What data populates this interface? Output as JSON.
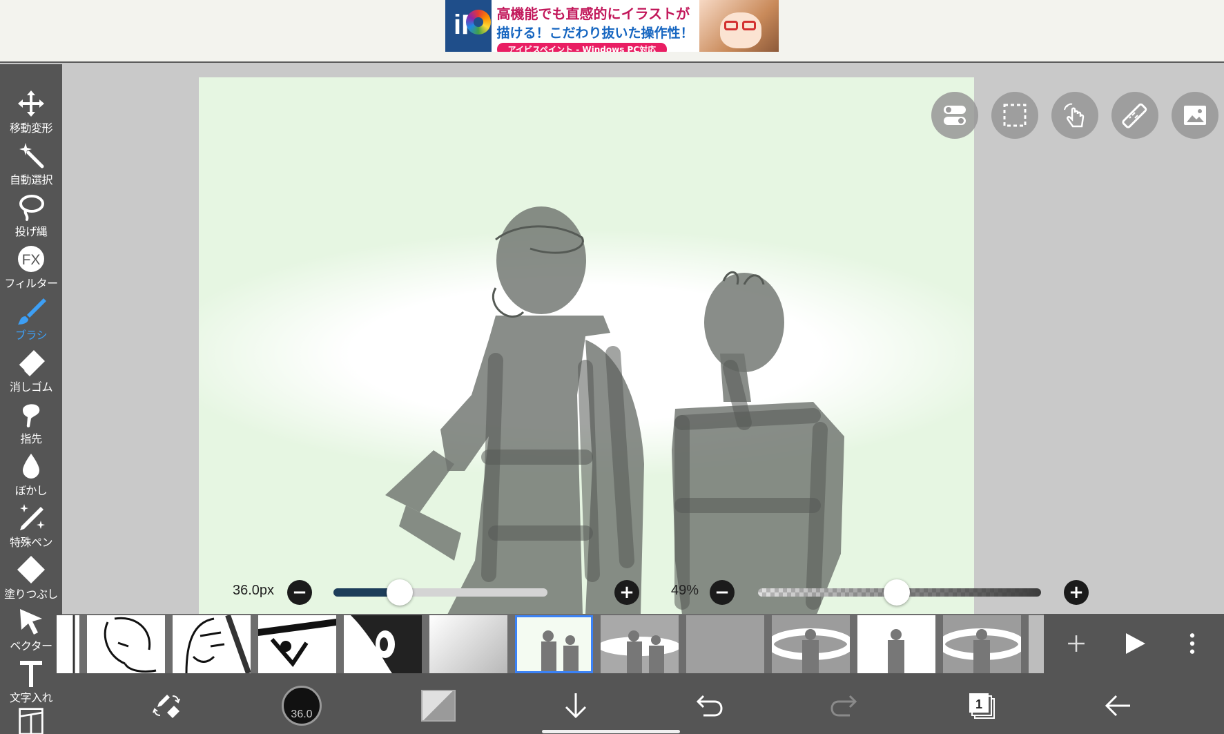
{
  "ad": {
    "logo": "iP",
    "line1": "高機能でも直感的にイラストが",
    "line2": "描ける！こだわり抜いた操作性！",
    "tagline": "アイビスペイント - Windows PC対応"
  },
  "tools": [
    {
      "id": "move",
      "label": "移動変形",
      "icon": "move-icon"
    },
    {
      "id": "magic",
      "label": "自動選択",
      "icon": "magic-wand-icon"
    },
    {
      "id": "lasso",
      "label": "投げ縄",
      "icon": "lasso-icon"
    },
    {
      "id": "filter",
      "label": "フィルター",
      "icon": "fx-icon"
    },
    {
      "id": "brush",
      "label": "ブラシ",
      "icon": "brush-icon",
      "active": true
    },
    {
      "id": "eraser",
      "label": "消しゴム",
      "icon": "eraser-icon"
    },
    {
      "id": "smudge",
      "label": "指先",
      "icon": "finger-icon"
    },
    {
      "id": "blur",
      "label": "ぼかし",
      "icon": "drop-icon"
    },
    {
      "id": "special",
      "label": "特殊ペン",
      "icon": "sparkle-pen-icon"
    },
    {
      "id": "fill",
      "label": "塗りつぶし",
      "icon": "bucket-icon"
    },
    {
      "id": "vector",
      "label": "ベクター",
      "icon": "cursor-icon"
    },
    {
      "id": "text",
      "label": "文字入れ",
      "icon": "text-icon"
    }
  ],
  "floating_buttons": [
    "toggle-icon",
    "selection-icon",
    "hand-icon",
    "ruler-icon",
    "image-icon"
  ],
  "brush_size": {
    "label": "36.0px",
    "fraction": 0.31
  },
  "opacity": {
    "label": "49%",
    "fraction": 0.49
  },
  "brush_size_badge": "36.0",
  "layers": {
    "count_badge": "1",
    "selected_index": 5
  },
  "colors": {
    "accent": "#3d9ff5",
    "toolbar_bg": "#555555",
    "canvas_bg": "#e6f6e2",
    "selected_outline": "#3b82f6"
  }
}
